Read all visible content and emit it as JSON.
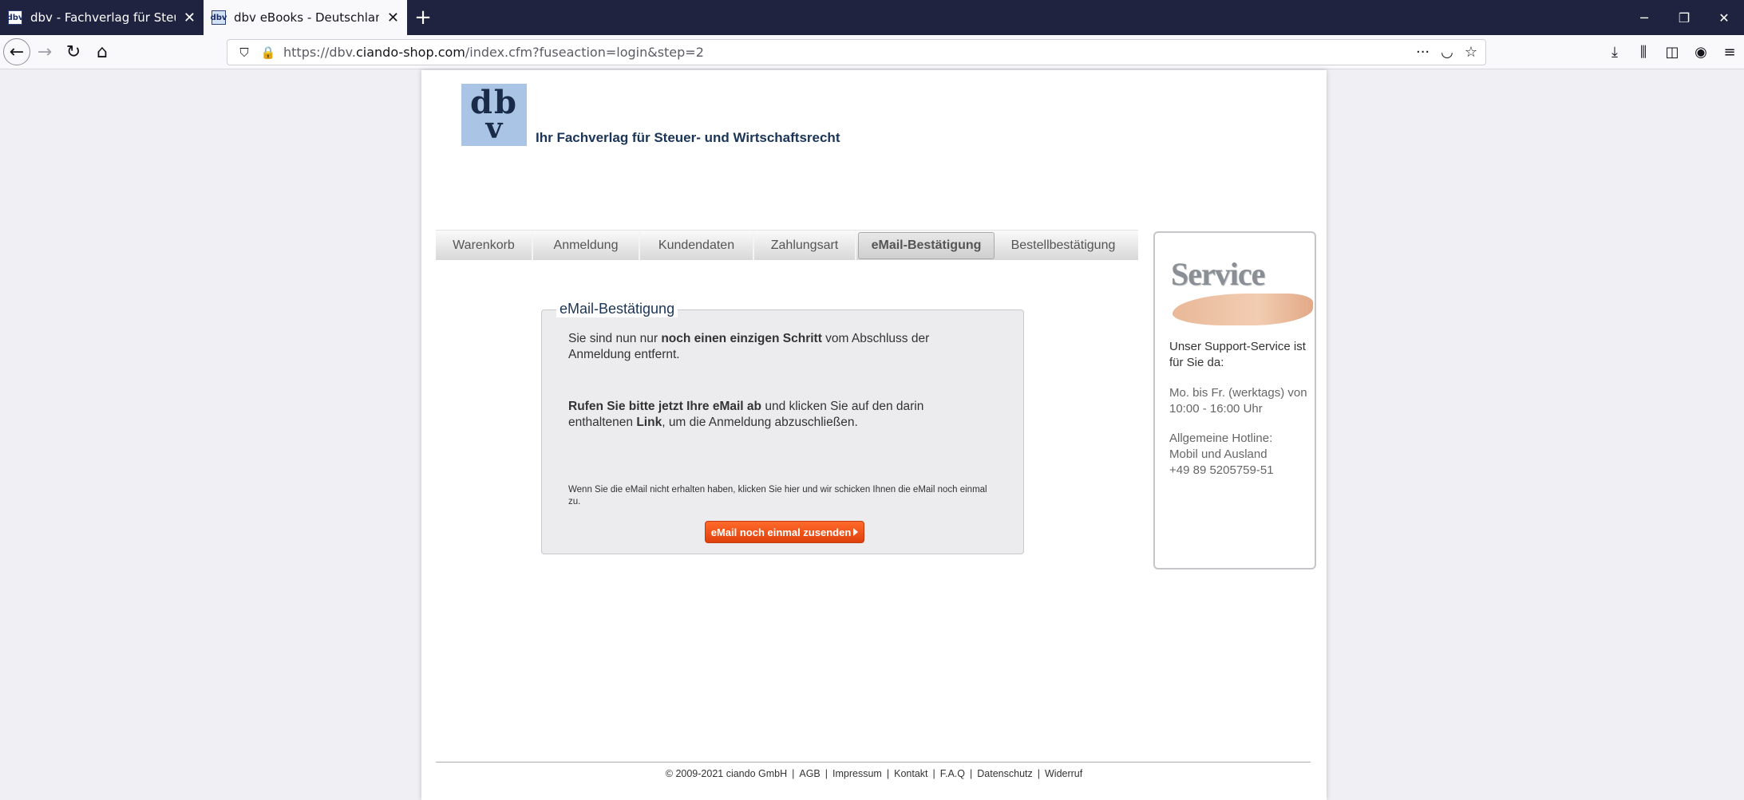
{
  "browser": {
    "tabs": [
      {
        "title": "dbv - Fachverlag für Steuer- und",
        "active": false
      },
      {
        "title": "dbv eBooks - Deutschlands größ",
        "active": true
      }
    ],
    "new_tab": "+",
    "url_prefix": "https://dbv.",
    "url_domain": "ciando-shop.com",
    "url_path": "/index.cfm?fuseaction=login&step=2"
  },
  "header": {
    "logo_top": "db",
    "logo_bottom": "v",
    "tagline": "Ihr Fachverlag für Steuer- und Wirtschaftsrecht"
  },
  "steps": [
    {
      "label": "Warenkorb",
      "active": false
    },
    {
      "label": "Anmeldung",
      "active": false
    },
    {
      "label": "Kundendaten",
      "active": false
    },
    {
      "label": "Zahlungsart",
      "active": false
    },
    {
      "label": "eMail-Bestätigung",
      "active": true
    },
    {
      "label": "Bestellbestätigung",
      "active": false
    }
  ],
  "confirm": {
    "legend": "eMail-Bestätigung",
    "p1_a": "Sie sind nun nur ",
    "p1_b": "noch einen einzigen Schritt",
    "p1_c": " vom Abschluss der Anmeldung entfernt.",
    "p2_a": "Rufen Sie bitte jetzt Ihre eMail ab",
    "p2_b": " und klicken Sie auf den darin enthaltenen ",
    "p2_c": "Link",
    "p2_d": ", um die Anmeldung abzuschließen.",
    "small": "Wenn Sie die eMail nicht erhalten haben, klicken Sie hier und wir schicken Ihnen die eMail noch einmal zu.",
    "resend_label": "eMail noch einmal zusenden"
  },
  "service": {
    "word": "Service",
    "line1": "Unser Support-Service ist für Sie da:",
    "line2": "Mo. bis Fr. (werktags) von 10:00 - 16:00 Uhr",
    "line3a": "Allgemeine Hotline:",
    "line3b": "Mobil und Ausland",
    "line3c": "+49 89 5205759-51"
  },
  "footer": {
    "copyright": "© 2009-2021 ciando GmbH",
    "links": [
      "AGB",
      "Impressum",
      "Kontakt",
      "F.A.Q",
      "Datenschutz",
      "Widerruf"
    ]
  },
  "colors": {
    "tabbar": "#202340",
    "accent_orange": "#e84e12",
    "logo_bg": "#a9c4e4",
    "brand_text": "#1a3557"
  }
}
